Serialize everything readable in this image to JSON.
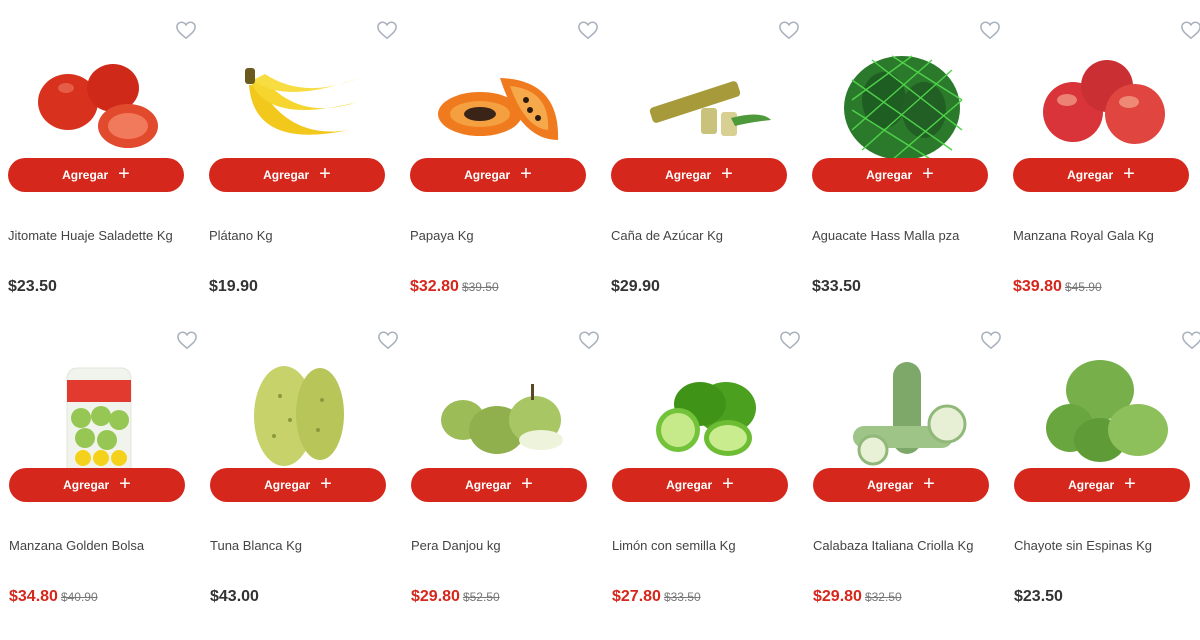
{
  "add_label": "Agregar",
  "add_icon": "plus-icon",
  "favorite_icon": "heart-outline-icon",
  "colors": {
    "accent": "#d5271b",
    "heart": "#a9b1bd"
  },
  "products": [
    {
      "name": "Jitomate Huaje Saladette Kg",
      "price": "$23.50",
      "old_price": "",
      "image": "tomato"
    },
    {
      "name": "Plátano Kg",
      "price": "$19.90",
      "old_price": "",
      "image": "banana"
    },
    {
      "name": "Papaya Kg",
      "price": "$32.80",
      "old_price": "$39.50",
      "image": "papaya"
    },
    {
      "name": "Caña de Azúcar Kg",
      "price": "$29.90",
      "old_price": "",
      "image": "sugarcane"
    },
    {
      "name": "Aguacate Hass Malla pza",
      "price": "$33.50",
      "old_price": "",
      "image": "avocado-mesh"
    },
    {
      "name": "Manzana Royal Gala Kg",
      "price": "$39.80",
      "old_price": "$45.90",
      "image": "apples-red"
    },
    {
      "name": "Manzana Golden Bolsa",
      "price": "$34.80",
      "old_price": "$40.90",
      "image": "apples-bag"
    },
    {
      "name": "Tuna Blanca Kg",
      "price": "$43.00",
      "old_price": "",
      "image": "prickly-pear"
    },
    {
      "name": "Pera Danjou kg",
      "price": "$29.80",
      "old_price": "$52.50",
      "image": "pears"
    },
    {
      "name": "Limón con semilla Kg",
      "price": "$27.80",
      "old_price": "$33.50",
      "image": "limes"
    },
    {
      "name": "Calabaza Italiana Criolla Kg",
      "price": "$29.80",
      "old_price": "$32.50",
      "image": "zucchini"
    },
    {
      "name": "Chayote sin Espinas Kg",
      "price": "$23.50",
      "old_price": "",
      "image": "chayote"
    }
  ]
}
